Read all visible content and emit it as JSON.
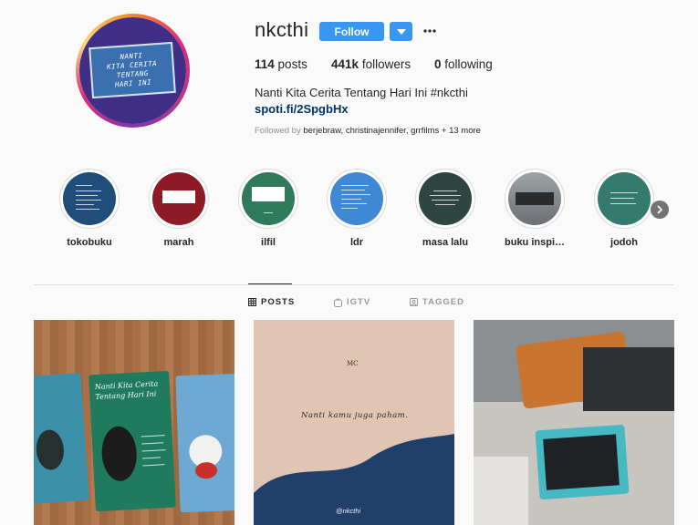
{
  "profile": {
    "username": "nkcthi",
    "follow_label": "Follow",
    "avatar_text": [
      "NANTI",
      "KITA CERITA",
      "TENTANG",
      "HARI INI"
    ],
    "stats": {
      "posts_count": "114",
      "posts_label": "posts",
      "followers_count": "441k",
      "followers_label": "followers",
      "following_count": "0",
      "following_label": "following"
    },
    "bio": "Nanti Kita Cerita Tentang Hari Ini #nkcthi",
    "link": "spoti.fi/2SpgbHx",
    "followed_by_prefix": "Followed by",
    "followed_by_names": "berjebraw, christinajennifer, grrfilms",
    "followed_by_more": "+ 13 more"
  },
  "highlights": [
    {
      "label": "tokobuku",
      "color": "#1f4e7a"
    },
    {
      "label": "marah",
      "color": "#8e1a28"
    },
    {
      "label": "ilfil",
      "color": "#2f7a5a"
    },
    {
      "label": "ldr",
      "color": "#3f88d6"
    },
    {
      "label": "masa lalu",
      "color": "#2f4640"
    },
    {
      "label": "buku inspi…",
      "color": "#6b6f73"
    },
    {
      "label": "jodoh",
      "color": "#347a6e"
    }
  ],
  "tabs": [
    {
      "label": "POSTS",
      "icon": "grid-icon",
      "active": true
    },
    {
      "label": "IGTV",
      "icon": "igtv-icon",
      "active": false
    },
    {
      "label": "TAGGED",
      "icon": "tagged-icon",
      "active": false
    }
  ],
  "posts": {
    "p1_card_text": [
      "Nanti Kita Cerita",
      "Tentang Hari Ini"
    ],
    "p2_small": "MC",
    "p2_line": "Nanti kamu juga paham.",
    "p2_handle": "@nkcthi"
  },
  "colors": {
    "accent": "#3897f0",
    "link": "#003569",
    "muted": "#8e8e8e"
  }
}
